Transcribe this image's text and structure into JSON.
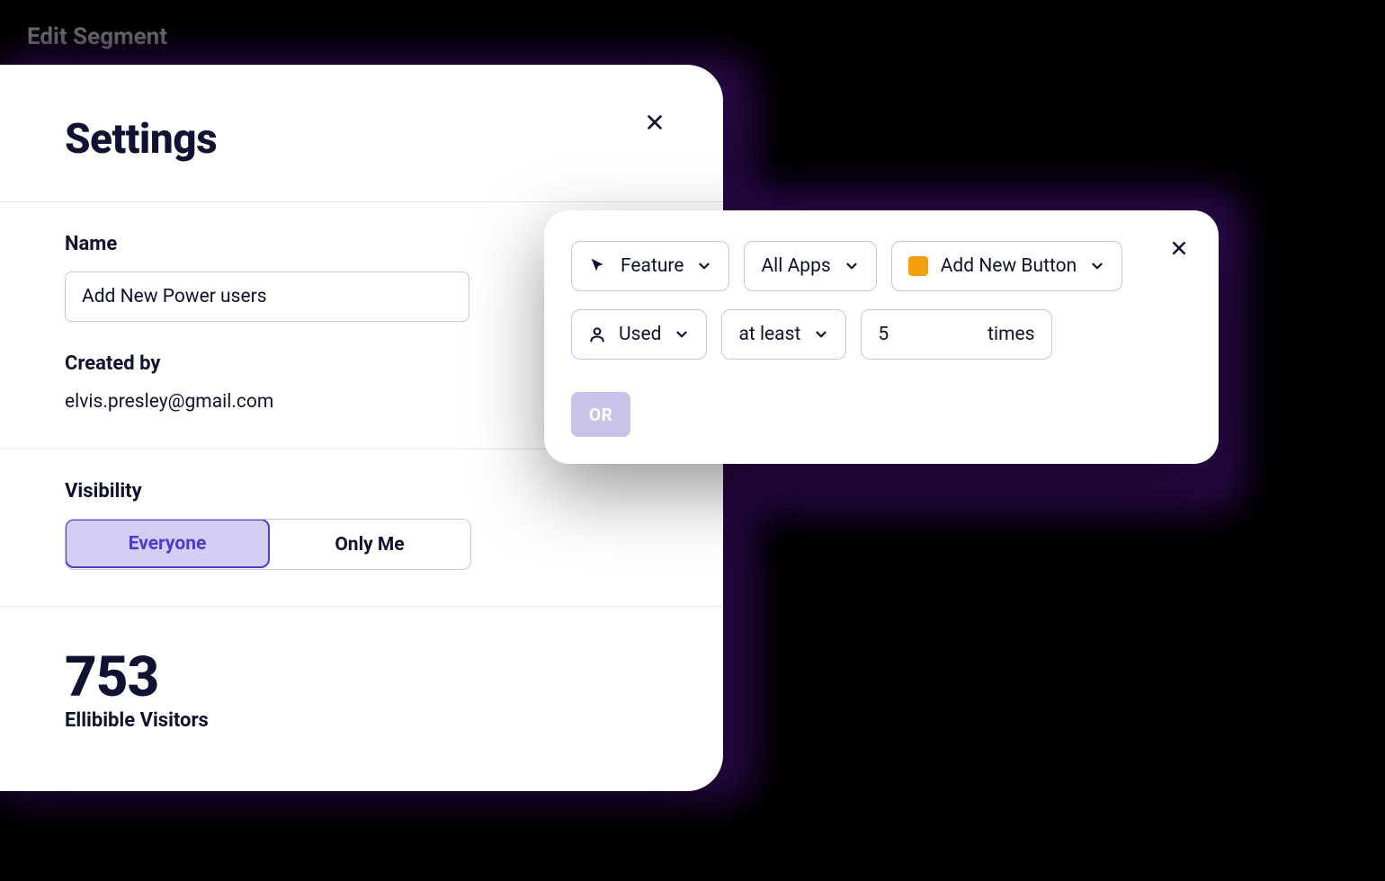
{
  "page": {
    "title": "Edit Segment"
  },
  "settings": {
    "title": "Settings",
    "name": {
      "label": "Name",
      "value": "Add New Power users"
    },
    "created_by": {
      "label": "Created by",
      "value": "elvis.presley@gmail.com"
    },
    "visibility": {
      "label": "Visibility",
      "options": {
        "everyone": "Everyone",
        "only_me": "Only Me"
      },
      "selected": "everyone"
    },
    "stat": {
      "count": "753",
      "label": "Ellibible Visitors"
    }
  },
  "rule": {
    "filter_type": "Feature",
    "app_scope": "All Apps",
    "feature": "Add New Button",
    "feature_color": "#f59e0b",
    "usage_verb": "Used",
    "comparator": "at least",
    "threshold": "5",
    "unit": "times",
    "or_label": "OR"
  }
}
